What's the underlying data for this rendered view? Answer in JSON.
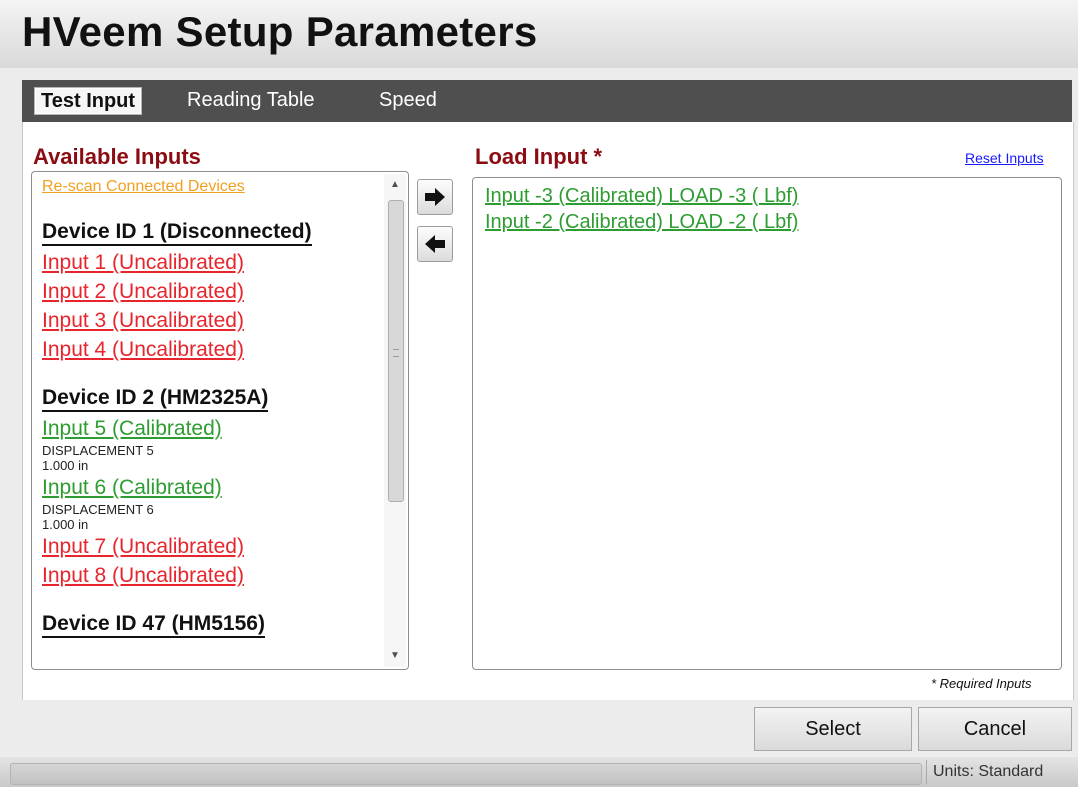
{
  "window": {
    "title": "HVeem Setup Parameters"
  },
  "tabs": [
    {
      "label": "Test Input",
      "active": true
    },
    {
      "label": "Reading Table",
      "active": false
    },
    {
      "label": "Speed",
      "active": false
    }
  ],
  "available": {
    "title": "Available Inputs",
    "rescan_label": "Re-scan Connected Devices",
    "devices": [
      {
        "title": "Device ID 1 (Disconnected)",
        "inputs": [
          {
            "label": "Input 1 (Uncalibrated)",
            "status": "uncalibrated"
          },
          {
            "label": "Input 2 (Uncalibrated)",
            "status": "uncalibrated"
          },
          {
            "label": "Input 3 (Uncalibrated)",
            "status": "uncalibrated"
          },
          {
            "label": "Input 4 (Uncalibrated)",
            "status": "uncalibrated"
          }
        ]
      },
      {
        "title": "Device ID 2 (HM2325A)",
        "inputs": [
          {
            "label": "Input 5 (Calibrated)",
            "status": "calibrated",
            "name": "DISPLACEMENT 5",
            "value": "1.000 in"
          },
          {
            "label": "Input 6 (Calibrated)",
            "status": "calibrated",
            "name": "DISPLACEMENT 6",
            "value": "1.000 in"
          },
          {
            "label": "Input 7 (Uncalibrated)",
            "status": "uncalibrated"
          },
          {
            "label": "Input 8 (Uncalibrated)",
            "status": "uncalibrated"
          }
        ]
      },
      {
        "title": "Device ID 47 (HM5156)",
        "inputs": []
      }
    ]
  },
  "load": {
    "title": "Load Input *",
    "reset_label": "Reset Inputs",
    "items": [
      "Input -3 (Calibrated) LOAD -3 ( Lbf)",
      "Input -2 (Calibrated) LOAD -2 ( Lbf)"
    ]
  },
  "required_note": "* Required Inputs",
  "buttons": {
    "select": "Select",
    "cancel": "Cancel"
  },
  "status": {
    "units": "Units: Standard"
  },
  "colors": {
    "section_title": "#8b0d13",
    "calibrated": "#2e9d31",
    "uncalibrated": "#e8242c",
    "rescan": "#f2a01f",
    "tab_strip": "#4f4f4f"
  },
  "icons": {
    "add": "arrow-right-icon",
    "remove": "arrow-left-icon",
    "scroll_up": "scroll-up-icon",
    "scroll_down": "scroll-down-icon"
  }
}
